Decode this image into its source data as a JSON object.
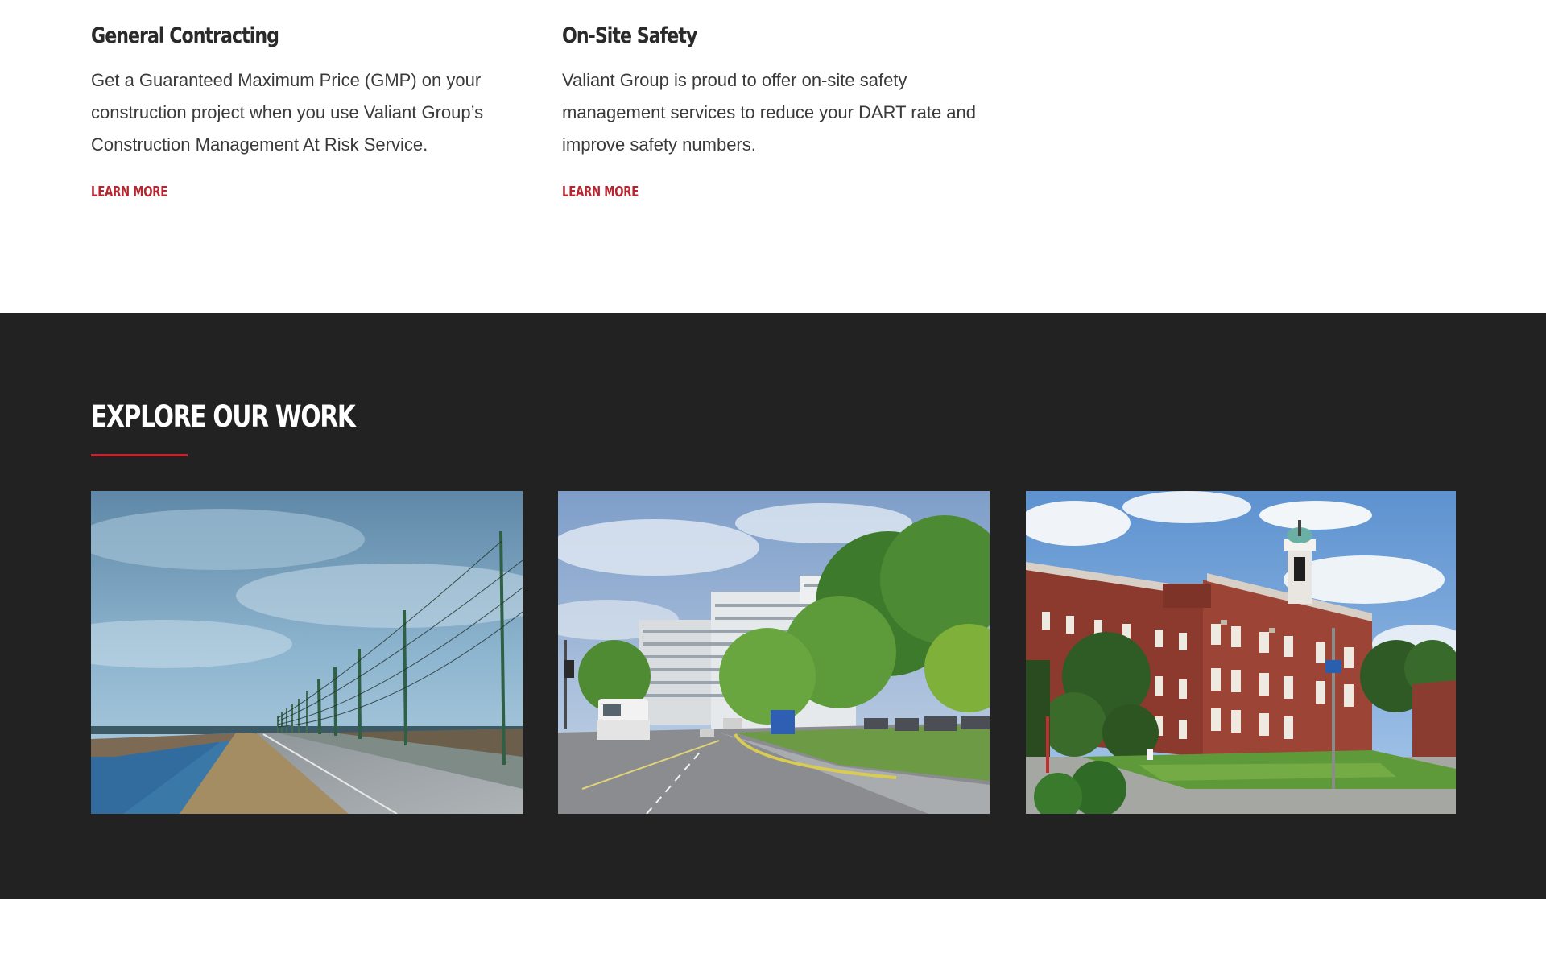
{
  "services": [
    {
      "title": "General Contracting",
      "description": "Get a Guaranteed Maximum Price (GMP) on your construction project when you use Valiant Group’s Construction Management At Risk Service.",
      "link_label": "LEARN MORE"
    },
    {
      "title": "On-Site Safety",
      "description": "Valiant Group is proud to offer on-site safety management services to reduce your DART rate and improve safety numbers.",
      "link_label": "LEARN MORE"
    }
  ],
  "work": {
    "heading": "EXPLORE OUR WORK",
    "projects": [
      {
        "image": "coastal-road-power-lines-photo"
      },
      {
        "image": "hospital-campus-street-photo"
      },
      {
        "image": "brick-building-cupola-photo"
      }
    ]
  },
  "colors": {
    "accent": "#c4242c",
    "dark_section": "#222223",
    "link": "#b6252f"
  }
}
